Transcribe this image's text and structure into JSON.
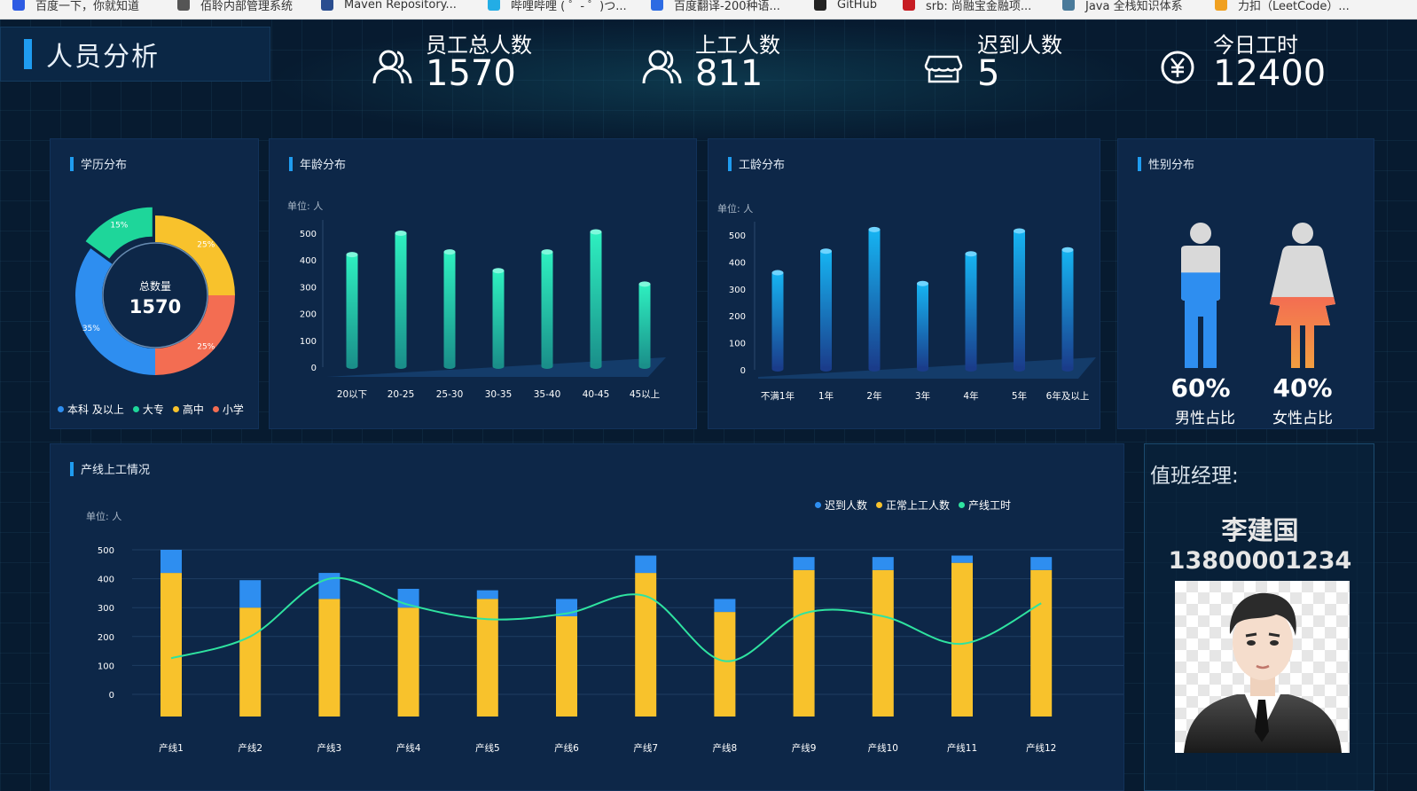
{
  "bookmarks": [
    {
      "label": "百度一下，你就知道",
      "color": "#2d5be3"
    },
    {
      "label": "佰聆内部管理系统",
      "color": "#555555"
    },
    {
      "label": "Maven Repository...",
      "color": "#2a4d8f"
    },
    {
      "label": "哔哩哔哩 ( ゜- ゜)つ...",
      "color": "#23ade5"
    },
    {
      "label": "百度翻译-200种语...",
      "color": "#2d6be3"
    },
    {
      "label": "GitHub",
      "color": "#222222"
    },
    {
      "label": "srb: 尚融宝金融项...",
      "color": "#c71d23"
    },
    {
      "label": "Java 全栈知识体系",
      "color": "#4a7a9a"
    },
    {
      "label": "力扣（LeetCode）...",
      "color": "#f0a020"
    }
  ],
  "header": {
    "title": "人员分析",
    "stats": [
      {
        "label": "员工总人数",
        "value": "1570",
        "icon": "users-icon"
      },
      {
        "label": "上工人数",
        "value": "811",
        "icon": "user-icon"
      },
      {
        "label": "迟到人数",
        "value": "5",
        "icon": "store-icon"
      },
      {
        "label": "今日工时",
        "value": "12400",
        "icon": "yen-icon"
      }
    ]
  },
  "education": {
    "title": "学历分布",
    "center_label": "总数量",
    "center_value": "1570",
    "legend": [
      {
        "name": "本科 及以上",
        "color": "#2e8ef0"
      },
      {
        "name": "大专",
        "color": "#1ed69a"
      },
      {
        "name": "高中",
        "color": "#f8c22c"
      },
      {
        "name": "小学",
        "color": "#f36d52"
      }
    ]
  },
  "age": {
    "title": "年龄分布",
    "unit": "单位: 人"
  },
  "seniority": {
    "title": "工龄分布",
    "unit": "单位: 人"
  },
  "gender": {
    "title": "性别分布",
    "male_pct": "60%",
    "male_label": "男性占比",
    "male_ratio": 0.6,
    "female_pct": "40%",
    "female_label": "女性占比",
    "female_ratio": 0.4,
    "colors": {
      "male": "#2e8ef0",
      "female": "#f3774a",
      "body": "#d9d9d9"
    }
  },
  "production": {
    "title": "产线上工情况",
    "unit": "单位: 人"
  },
  "manager": {
    "title": "值班经理:",
    "name": "李建国",
    "phone": "13800001234"
  },
  "chart_data": [
    {
      "type": "pie",
      "title": "学历分布",
      "categories": [
        "本科 及以上",
        "大专",
        "高中",
        "小学"
      ],
      "values": [
        35,
        15,
        25,
        25
      ],
      "labels": [
        "35%",
        "15%",
        "25%",
        "25%"
      ],
      "colors": [
        "#2e8ef0",
        "#1ed69a",
        "#f8c22c",
        "#f36d52"
      ]
    },
    {
      "type": "bar",
      "title": "年龄分布",
      "categories": [
        "20以下",
        "20-25",
        "25-30",
        "30-35",
        "35-40",
        "40-45",
        "45以上"
      ],
      "values": [
        420,
        500,
        430,
        360,
        430,
        505,
        310
      ],
      "ylim": [
        0,
        500
      ],
      "yticks": [
        0,
        100,
        200,
        300,
        400,
        500
      ],
      "color": "#20e0b0"
    },
    {
      "type": "bar",
      "title": "工龄分布",
      "categories": [
        "不满1年",
        "1年",
        "2年",
        "3年",
        "4年",
        "5年",
        "6年及以上"
      ],
      "values": [
        360,
        440,
        520,
        320,
        430,
        515,
        445
      ],
      "ylim": [
        0,
        500
      ],
      "yticks": [
        0,
        100,
        200,
        300,
        400,
        500
      ],
      "color": "#18a8f0"
    },
    {
      "type": "bar",
      "title": "产线上工情况",
      "categories": [
        "产线1",
        "产线2",
        "产线3",
        "产线4",
        "产线5",
        "产线6",
        "产线7",
        "产线8",
        "产线9",
        "产线10",
        "产线11",
        "产线12"
      ],
      "ylim": [
        0,
        500
      ],
      "yticks": [
        0,
        100,
        200,
        300,
        400,
        500
      ],
      "series": [
        {
          "name": "正常上工人数",
          "color": "#f8c22c",
          "values": [
            420,
            300,
            330,
            300,
            330,
            270,
            420,
            285,
            430,
            430,
            455,
            430
          ]
        },
        {
          "name": "迟到人数",
          "color": "#2e8ef0",
          "values": [
            80,
            95,
            90,
            65,
            30,
            60,
            60,
            45,
            45,
            45,
            25,
            45
          ]
        },
        {
          "name": "产线工时",
          "color": "#2fe3a0",
          "values": [
            125,
            200,
            400,
            310,
            260,
            280,
            340,
            115,
            280,
            270,
            175,
            315
          ]
        }
      ],
      "legend": [
        "迟到人数",
        "正常上工人数",
        "产线工时"
      ]
    }
  ]
}
